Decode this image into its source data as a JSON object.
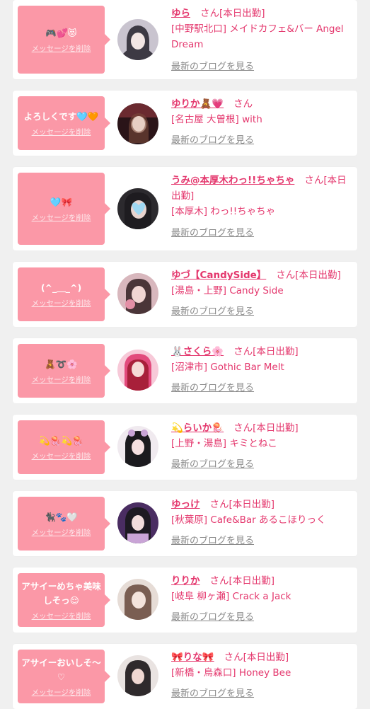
{
  "entries": [
    {
      "message": "🎮💕😻",
      "delete_label": "メッセージを削除",
      "name": "ゆら",
      "honorific": "さん",
      "status": "[本日出勤]",
      "shop": "[中野駅北口] メイドカフェ&バー Angel Dream",
      "blog_label": "最新のブログを見る",
      "avatar_colors": [
        "#c9c4cf",
        "#3d3a44",
        "#f2e6e4"
      ]
    },
    {
      "message": "よろしくです🩵🧡",
      "delete_label": "メッセージを削除",
      "name": "ゆりか🧸💗",
      "honorific": "さん",
      "status": "",
      "shop": "[名古屋 大曽根] with",
      "blog_label": "最新のブログを見る",
      "avatar_colors": [
        "#2a1418",
        "#6b2a30",
        "#e7cfc4"
      ]
    },
    {
      "message": "🩵🎀",
      "delete_label": "メッセージを削除",
      "name": "うみ@本厚木わっ!!ちゃちゃ",
      "honorific": "さん",
      "status": "[本日出勤]",
      "shop": "[本厚木] わっ!!ちゃちゃ",
      "blog_label": "最新のブログを見る",
      "avatar_colors": [
        "#2c2a2e",
        "#1e1c20",
        "#9fd8f2"
      ]
    },
    {
      "message": "(^_＿_^)",
      "delete_label": "メッセージを削除",
      "name": "ゆづ【CandySide】",
      "honorific": "さん",
      "status": "[本日出勤]",
      "shop": "[湯島・上野] Candy Side",
      "blog_label": "最新のブログを見る",
      "avatar_colors": [
        "#d8b7bd",
        "#4a3538",
        "#f1d6d3"
      ]
    },
    {
      "message": "🧸➰🌸",
      "delete_label": "メッセージを削除",
      "name": "🐰さくら🌸",
      "honorific": "さん",
      "status": "[本日出勤]",
      "shop": "[沼津市] Gothic Bar Melt",
      "blog_label": "最新のブログを見る",
      "avatar_colors": [
        "#e24a7c",
        "#a8203a",
        "#f7c9d8"
      ]
    },
    {
      "message": "💫🪼💫🪼",
      "delete_label": "メッセージを削除",
      "name": "💫らいか🪼",
      "honorific": "さん",
      "status": "[本日出勤]",
      "shop": "[上野・湯島] キミとねこ",
      "blog_label": "最新のブログを見る",
      "avatar_colors": [
        "#f0eaef",
        "#1b1a1e",
        "#f4dfe0"
      ]
    },
    {
      "message": "🐈‍⬛🐾🤍",
      "delete_label": "メッセージを削除",
      "name": "ゆっけ",
      "honorific": "さん",
      "status": "[本日出勤]",
      "shop": "[秋葉原] Cafe&Bar あるこほりっく",
      "blog_label": "最新のブログを見る",
      "avatar_colors": [
        "#4a2d62",
        "#1d1a22",
        "#c9a4d6"
      ]
    },
    {
      "message": "アサイーめちゃ美味しそっ😌",
      "delete_label": "メッセージを削除",
      "name": "りりか",
      "honorific": "さん",
      "status": "[本日出勤]",
      "shop": "[岐阜 柳ヶ瀬] Crack a Jack",
      "blog_label": "最新のブログを見る",
      "avatar_colors": [
        "#e6dcd6",
        "#7a5e52",
        "#f4e4dc"
      ]
    },
    {
      "message": "アサイーおいしそ〜♡",
      "delete_label": "メッセージを削除",
      "name": "🎀りな🎀",
      "honorific": "さん",
      "status": "[本日出勤]",
      "shop": "[新橋・烏森口] Honey Bee",
      "blog_label": "最新のブログを見る",
      "avatar_colors": [
        "#e9e3e1",
        "#2f2a2c",
        "#f0d8d2"
      ]
    }
  ]
}
